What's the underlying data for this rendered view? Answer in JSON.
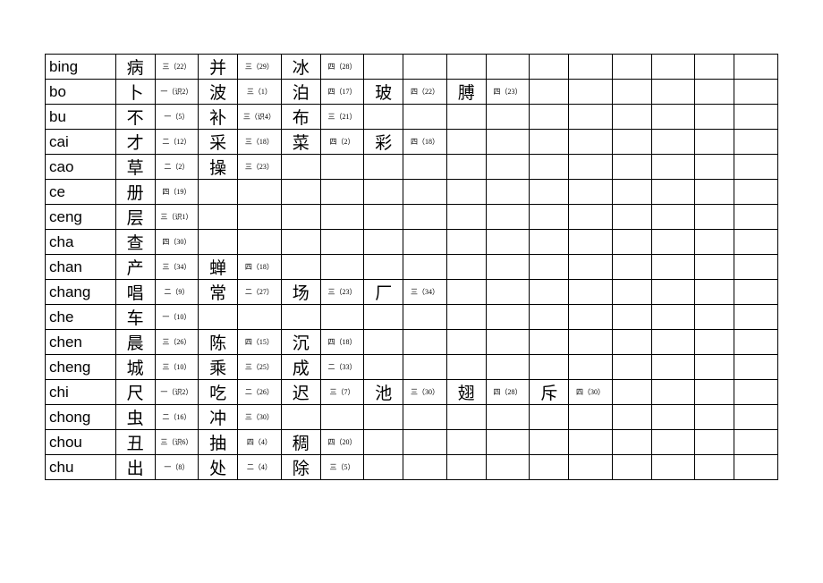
{
  "rows": [
    {
      "pinyin": "bing",
      "cells": [
        "病",
        "三（22）",
        "并",
        "三（29）",
        "冰",
        "四（28）",
        "",
        "",
        "",
        "",
        "",
        "",
        "",
        "",
        "",
        ""
      ]
    },
    {
      "pinyin": "bo",
      "cells": [
        "卜",
        "一（识2）",
        "波",
        "三（1）",
        "泊",
        "四（17）",
        "玻",
        "四（22）",
        "膊",
        "四（23）",
        "",
        "",
        "",
        "",
        "",
        ""
      ]
    },
    {
      "pinyin": "bu",
      "cells": [
        "不",
        "一（5）",
        "补",
        "三（识4）",
        "布",
        "三（21）",
        "",
        "",
        "",
        "",
        "",
        "",
        "",
        "",
        "",
        ""
      ]
    },
    {
      "pinyin": "cai",
      "cells": [
        "才",
        "二（12）",
        "采",
        "三（18）",
        "菜",
        "四（2）",
        "彩",
        "四（18）",
        "",
        "",
        "",
        "",
        "",
        "",
        "",
        ""
      ]
    },
    {
      "pinyin": "cao",
      "cells": [
        "草",
        "二（2）",
        "操",
        "三（23）",
        "",
        "",
        "",
        "",
        "",
        "",
        "",
        "",
        "",
        "",
        "",
        ""
      ]
    },
    {
      "pinyin": "ce",
      "cells": [
        "册",
        "四（19）",
        "",
        "",
        "",
        "",
        "",
        "",
        "",
        "",
        "",
        "",
        "",
        "",
        "",
        ""
      ]
    },
    {
      "pinyin": "ceng",
      "cells": [
        "层",
        "三（识1）",
        "",
        "",
        "",
        "",
        "",
        "",
        "",
        "",
        "",
        "",
        "",
        "",
        "",
        ""
      ]
    },
    {
      "pinyin": "cha",
      "cells": [
        "查",
        "四（30）",
        "",
        "",
        "",
        "",
        "",
        "",
        "",
        "",
        "",
        "",
        "",
        "",
        "",
        ""
      ]
    },
    {
      "pinyin": "chan",
      "cells": [
        "产",
        "三（34）",
        "蝉",
        "四（18）",
        "",
        "",
        "",
        "",
        "",
        "",
        "",
        "",
        "",
        "",
        "",
        ""
      ]
    },
    {
      "pinyin": "chang",
      "cells": [
        "唱",
        "二（9）",
        "常",
        "二（27）",
        "场",
        "三（23）",
        "厂",
        "三（34）",
        "",
        "",
        "",
        "",
        "",
        "",
        "",
        ""
      ]
    },
    {
      "pinyin": "che",
      "cells": [
        "车",
        "一（10）",
        "",
        "",
        "",
        "",
        "",
        "",
        "",
        "",
        "",
        "",
        "",
        "",
        "",
        ""
      ]
    },
    {
      "pinyin": "chen",
      "cells": [
        "晨",
        "三（26）",
        "陈",
        "四（15）",
        "沉",
        "四（18）",
        "",
        "",
        "",
        "",
        "",
        "",
        "",
        "",
        "",
        ""
      ]
    },
    {
      "pinyin": "cheng",
      "cells": [
        "城",
        "三（10）",
        "乘",
        "三（25）",
        "成",
        "二（33）",
        "",
        "",
        "",
        "",
        "",
        "",
        "",
        "",
        "",
        ""
      ]
    },
    {
      "pinyin": "chi",
      "cells": [
        "尺",
        "一（识2）",
        "吃",
        "二（26）",
        "迟",
        "三（7）",
        "池",
        "三（30）",
        "翅",
        "四（28）",
        "斥",
        "四（30）",
        "",
        "",
        "",
        ""
      ]
    },
    {
      "pinyin": "chong",
      "cells": [
        "虫",
        "二（16）",
        "冲",
        "三（30）",
        "",
        "",
        "",
        "",
        "",
        "",
        "",
        "",
        "",
        "",
        "",
        ""
      ]
    },
    {
      "pinyin": "chou",
      "cells": [
        "丑",
        "三（识6）",
        "抽",
        "四（4）",
        "稠",
        "四（20）",
        "",
        "",
        "",
        "",
        "",
        "",
        "",
        "",
        "",
        ""
      ]
    },
    {
      "pinyin": "chu",
      "cells": [
        "出",
        "一（8）",
        "处",
        "二（4）",
        "除",
        "三（5）",
        "",
        "",
        "",
        "",
        "",
        "",
        "",
        "",
        "",
        ""
      ]
    }
  ]
}
